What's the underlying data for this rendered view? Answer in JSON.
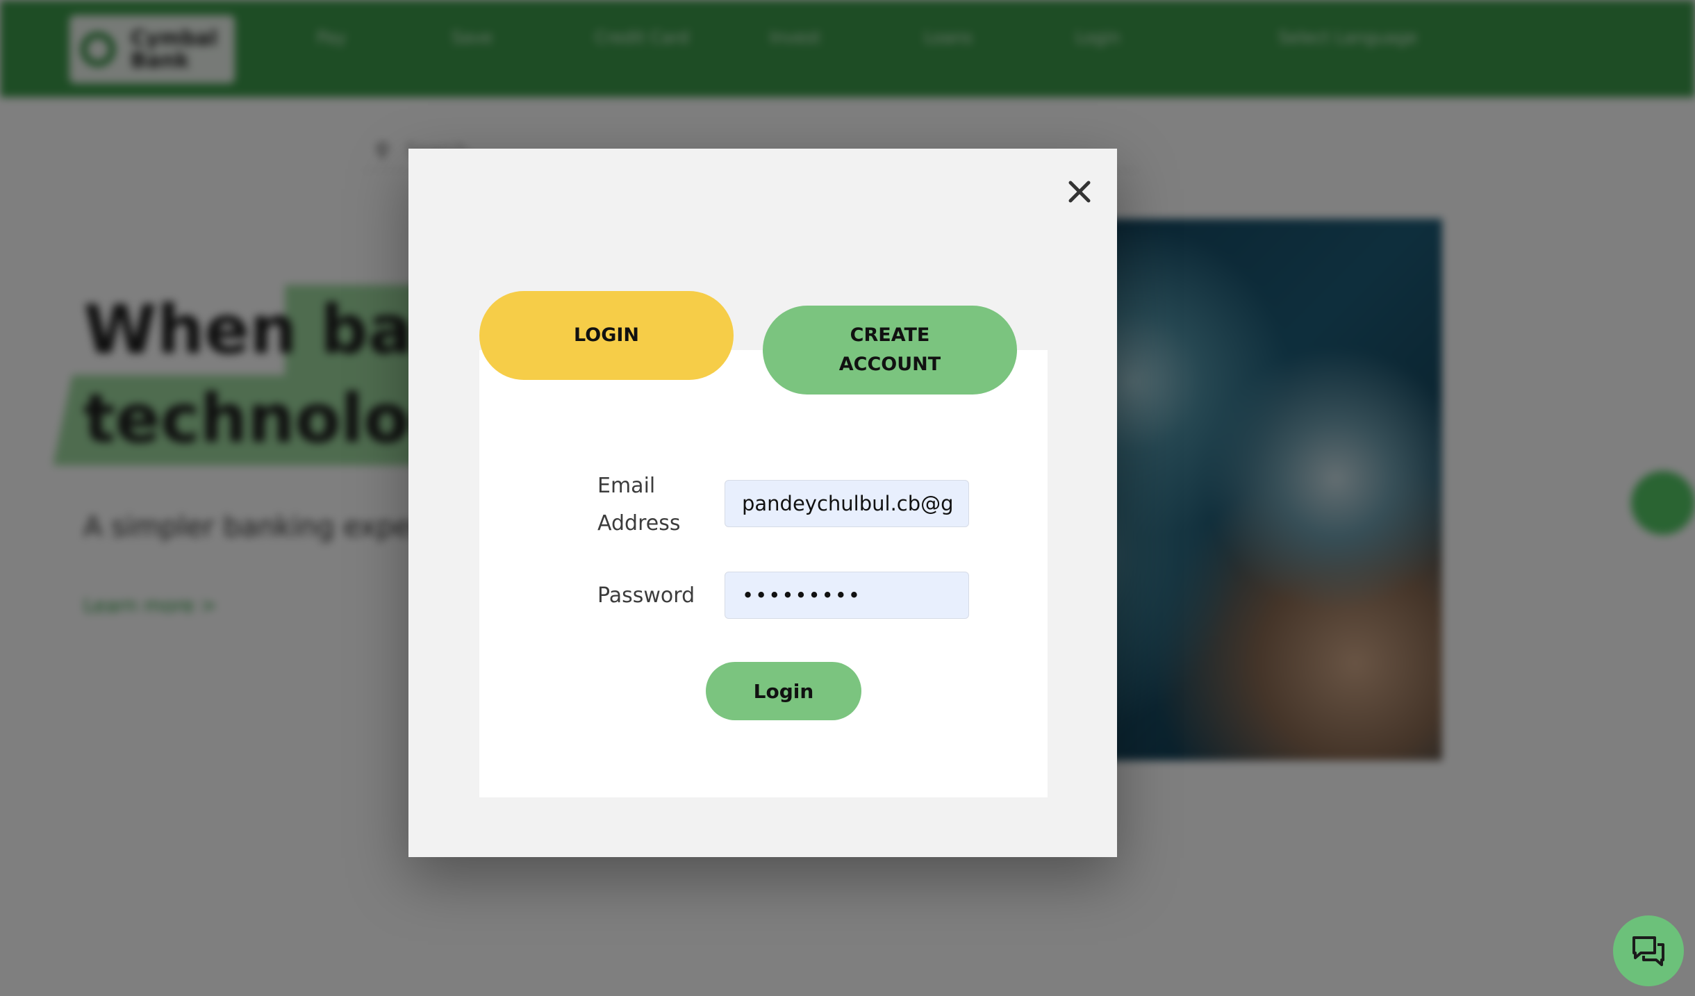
{
  "header": {
    "logo_text": "Cymbal Bank",
    "nav": [
      "Pay",
      "Save",
      "Credit Card",
      "Invest",
      "Loans",
      "Login",
      "Select Language"
    ]
  },
  "search": {
    "placeholder": "Search..."
  },
  "hero": {
    "line1": "When banking meets",
    "line2": "technology",
    "subtitle": "A simpler banking experience",
    "link": "Learn more >"
  },
  "modal": {
    "close_glyph": "✕",
    "tab_login": "LOGIN",
    "tab_create": "CREATE ACCOUNT",
    "email_label": "Email Address",
    "email_value": "pandeychulbul.cb@gmail.com",
    "password_label": "Password",
    "password_value": "•••••••••",
    "submit_label": "Login"
  },
  "colors": {
    "brand_green": "#3c9a4a",
    "tab_login_bg": "#f6cd48",
    "button_green": "#7bc47f",
    "input_bg": "#e8effd"
  },
  "icons": {
    "close": "close-icon",
    "chat": "chat-icon",
    "search": "search-icon"
  }
}
